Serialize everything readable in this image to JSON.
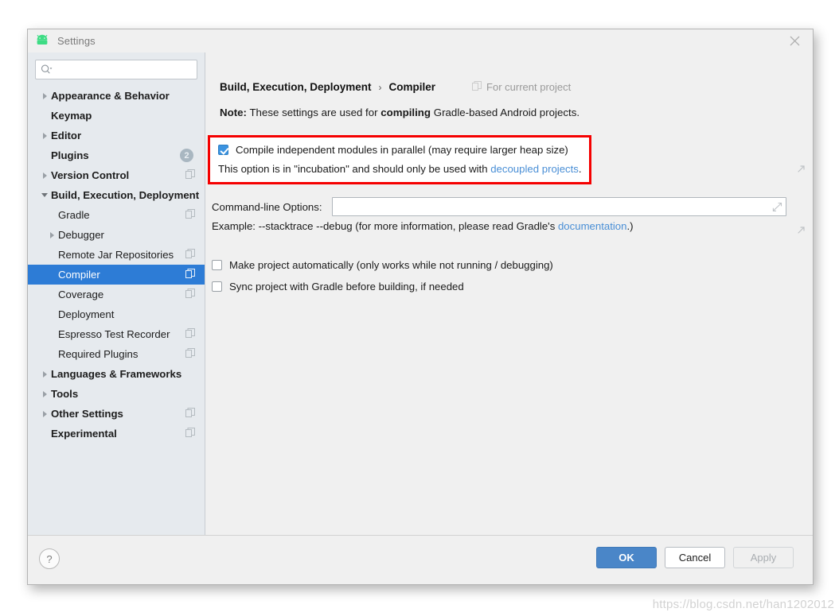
{
  "window": {
    "title": "Settings",
    "icon": "android-icon",
    "close_icon": "close-icon"
  },
  "sidebar": {
    "search": {
      "placeholder": "",
      "value": "",
      "icon": "search-icon"
    },
    "items": [
      {
        "label": "Appearance & Behavior",
        "level": 0,
        "bold": true,
        "twisty": "right",
        "badge": "",
        "copy": false,
        "selected": false
      },
      {
        "label": "Keymap",
        "level": 0,
        "bold": true,
        "twisty": "none",
        "badge": "",
        "copy": false,
        "selected": false
      },
      {
        "label": "Editor",
        "level": 0,
        "bold": true,
        "twisty": "right",
        "badge": "",
        "copy": false,
        "selected": false
      },
      {
        "label": "Plugins",
        "level": 0,
        "bold": true,
        "twisty": "none",
        "badge": "2",
        "copy": false,
        "selected": false
      },
      {
        "label": "Version Control",
        "level": 0,
        "bold": true,
        "twisty": "right",
        "badge": "",
        "copy": true,
        "selected": false
      },
      {
        "label": "Build, Execution, Deployment",
        "level": 0,
        "bold": true,
        "twisty": "down",
        "badge": "",
        "copy": false,
        "selected": false
      },
      {
        "label": "Gradle",
        "level": 1,
        "bold": false,
        "twisty": "none",
        "badge": "",
        "copy": true,
        "selected": false
      },
      {
        "label": "Debugger",
        "level": 1,
        "bold": false,
        "twisty": "right",
        "badge": "",
        "copy": false,
        "selected": false
      },
      {
        "label": "Remote Jar Repositories",
        "level": 1,
        "bold": false,
        "twisty": "none",
        "badge": "",
        "copy": true,
        "selected": false
      },
      {
        "label": "Compiler",
        "level": 1,
        "bold": false,
        "twisty": "none",
        "badge": "",
        "copy": true,
        "selected": true
      },
      {
        "label": "Coverage",
        "level": 1,
        "bold": false,
        "twisty": "none",
        "badge": "",
        "copy": true,
        "selected": false
      },
      {
        "label": "Deployment",
        "level": 1,
        "bold": false,
        "twisty": "none",
        "badge": "",
        "copy": false,
        "selected": false
      },
      {
        "label": "Espresso Test Recorder",
        "level": 1,
        "bold": false,
        "twisty": "none",
        "badge": "",
        "copy": true,
        "selected": false
      },
      {
        "label": "Required Plugins",
        "level": 1,
        "bold": false,
        "twisty": "none",
        "badge": "",
        "copy": true,
        "selected": false
      },
      {
        "label": "Languages & Frameworks",
        "level": 0,
        "bold": true,
        "twisty": "right",
        "badge": "",
        "copy": false,
        "selected": false
      },
      {
        "label": "Tools",
        "level": 0,
        "bold": true,
        "twisty": "right",
        "badge": "",
        "copy": false,
        "selected": false
      },
      {
        "label": "Other Settings",
        "level": 0,
        "bold": true,
        "twisty": "right",
        "badge": "",
        "copy": true,
        "selected": false
      },
      {
        "label": "Experimental",
        "level": 0,
        "bold": true,
        "twisty": "none",
        "badge": "",
        "copy": true,
        "selected": false
      }
    ]
  },
  "content": {
    "breadcrumb": {
      "parent": "Build, Execution, Deployment",
      "separator": "›",
      "current": "Compiler"
    },
    "for_current_project": "For current project",
    "note": {
      "prefix": "Note:",
      "text_1": " These settings are used for ",
      "bold_word": "compiling",
      "text_2": " Gradle-based Android projects."
    },
    "parallel_option": {
      "checked": true,
      "label": "Compile independent modules in parallel (may require larger heap size)",
      "description_1": "This option is in \"incubation\" and should only be used with ",
      "link_text": "decoupled projects",
      "description_2": "."
    },
    "command_line": {
      "label": "Command-line Options:",
      "value": "",
      "placeholder": ""
    },
    "example": {
      "text_1": "Example: --stacktrace --debug (for more information, please read Gradle's ",
      "link_text": "documentation",
      "text_2": ".)"
    },
    "options": [
      {
        "checked": false,
        "label": "Make project automatically (only works while not running / debugging)"
      },
      {
        "checked": false,
        "label": "Sync project with Gradle before building, if needed"
      }
    ]
  },
  "footer": {
    "help_label": "?",
    "ok_label": "OK",
    "cancel_label": "Cancel",
    "apply_label": "Apply"
  },
  "watermark": "https://blog.csdn.net/han1202012",
  "colors": {
    "accent_selection": "#2d7cd6",
    "primary_button": "#4a86c8",
    "highlight_box": "#f50000",
    "link": "#4a8fd6",
    "sidebar_bg": "#e6eaee",
    "panel_bg": "#f0f0f0",
    "android_green": "#3ddc84"
  }
}
